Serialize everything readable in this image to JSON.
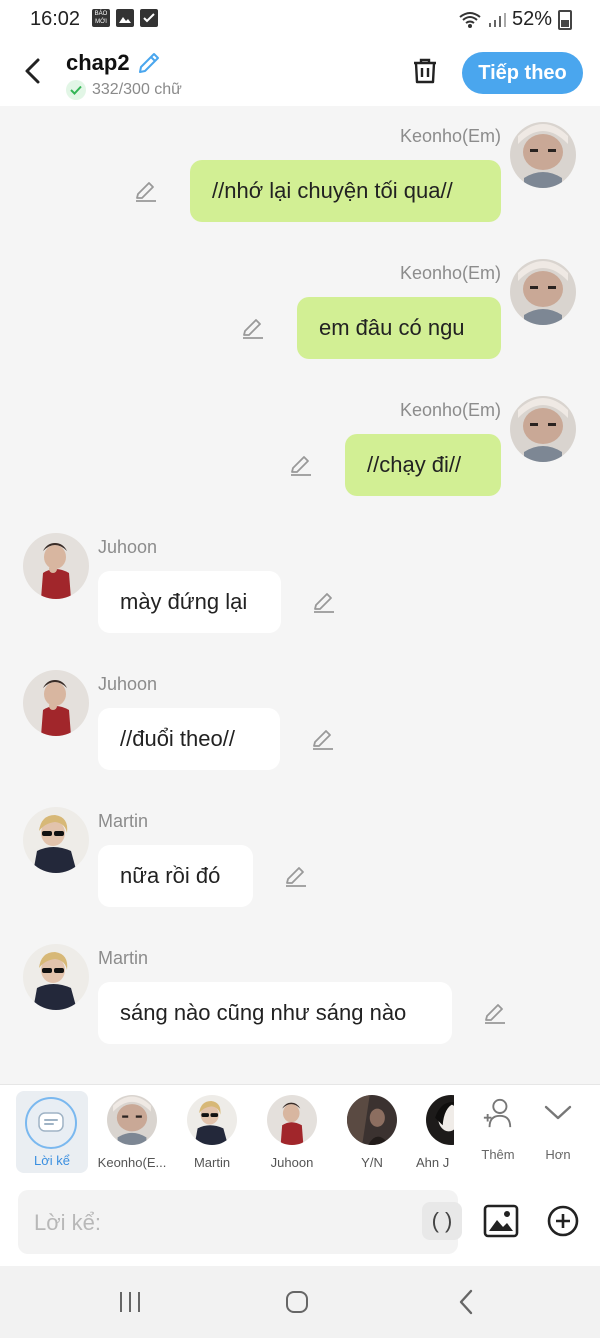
{
  "status": {
    "time": "16:02",
    "battery": "52%",
    "bao_moi": "BÁO MỚI"
  },
  "header": {
    "title": "chap2",
    "word_count": "332/300 chữ",
    "next_label": "Tiếp theo"
  },
  "messages": [
    {
      "side": "right",
      "name": "Keonho(Em)",
      "text": "//nhớ lại chuyện tối qua//",
      "avatar": "keonho"
    },
    {
      "side": "right",
      "name": "Keonho(Em)",
      "text": "em đâu có ngu",
      "avatar": "keonho"
    },
    {
      "side": "right",
      "name": "Keonho(Em)",
      "text": "//chạy đi//",
      "avatar": "keonho"
    },
    {
      "side": "left",
      "name": "Juhoon",
      "text": "mày đứng lại",
      "avatar": "juhoon"
    },
    {
      "side": "left",
      "name": "Juhoon",
      "text": "//đuổi theo//",
      "avatar": "juhoon"
    },
    {
      "side": "left",
      "name": "Martin",
      "text": "nữa rồi đó",
      "avatar": "martin"
    },
    {
      "side": "left",
      "name": "Martin",
      "text": "sáng nào cũng như sáng nào",
      "avatar": "martin"
    }
  ],
  "characters": {
    "narration": "Lời kể",
    "items": [
      {
        "label": "Keonho(E...",
        "avatar": "keonho"
      },
      {
        "label": "Martin",
        "avatar": "martin"
      },
      {
        "label": "Juhoon",
        "avatar": "juhoon"
      },
      {
        "label": "Y/N",
        "avatar": "yn"
      },
      {
        "label": "Ahn J",
        "avatar": "ahn"
      }
    ],
    "add_label": "Thêm",
    "more_label": "Hơn"
  },
  "input": {
    "placeholder": "Lời kể:",
    "paren_label": "( )"
  },
  "colors": {
    "accent": "#4aa6ee",
    "bubble_right": "#d2ef94",
    "bubble_left": "#ffffff",
    "background": "#f5f5f5"
  }
}
